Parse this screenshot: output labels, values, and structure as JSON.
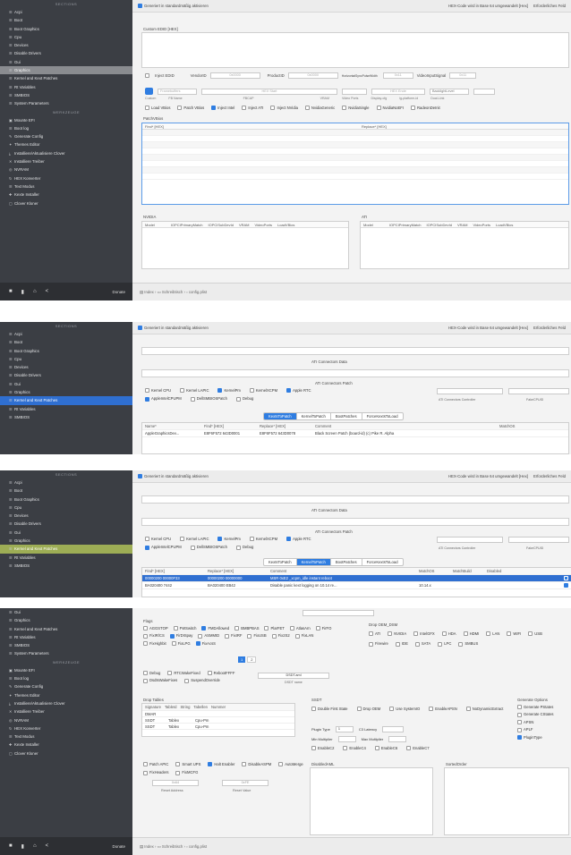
{
  "sidebar": {
    "section_main": "SECTIONS",
    "section_tools": "WERKZEUGE",
    "items": [
      "Acpi",
      "Boot",
      "Boot Graphics",
      "Cpu",
      "Devices",
      "Disable Drivers",
      "Gui",
      "Graphics",
      "Kernel and Kext Patches",
      "Rt Variables",
      "SMBIOS",
      "System Parameters"
    ],
    "tools": [
      "Mounte EFI",
      "Boot log",
      "Generate Config",
      "Themes Editor",
      "Installiere/Aktualisiere Clover",
      "Installiere Treiber",
      "NVRAM",
      "HEX Konverter",
      "Text Modus",
      "Kexte Installer",
      "Clover Kloner"
    ],
    "donate": "Donate"
  },
  "panel1": {
    "top_checkbox": "Generiert in standardmäßig aktivieren",
    "top_right": "HEX-Code wird in Base 64 umgewandelt [Hex]",
    "top_right2": "Erforderliches Feld",
    "custom_edid": "Custom EDID [HEX]",
    "inject_edid": "Inject EDID",
    "vendor_id": "VendorID",
    "vendor_placeholder": "0x0000",
    "product_id": "ProductID",
    "product_placeholder": "0x0000",
    "horizontal": "HorizontalSyncPulseWidth",
    "horizontal_val": "0x11",
    "video_input": "VideoInputSignal",
    "video_val": "0x11",
    "framebuffers": "Framebuffers",
    "hex_start": "HEX Start",
    "hex_end": "HEX Ende",
    "backlight": "BacklightLevel",
    "cols": [
      "Custom",
      "FB Name",
      "FBCAP",
      "VRAM",
      "Video Ports",
      "Display-cfg",
      "ig-platform-id",
      "Dual-Link"
    ],
    "checks": [
      "Load VBios",
      "Patch VBios",
      "Inject Intel",
      "Inject ATI",
      "Inject NVidia",
      "NvidiaGeneric",
      "NvidiaSingle",
      "NvidiaNoEFI",
      "RadeonDeInit"
    ],
    "checks_on": [
      false,
      false,
      true,
      false,
      false,
      false,
      false,
      false,
      false
    ],
    "patch_vbios_title": "PatchVBios",
    "find_hex": "Find* [HEX]",
    "replace_hex": "Replace* [HEX]",
    "nvidia_title": "NVIDIA",
    "ati_title": "ATI",
    "nvidia_cols": [
      "Model",
      "IOPCIPrimaryMatch",
      "IOPCISubDevId",
      "VRAM",
      "VideoPorts",
      "LoadVBios"
    ],
    "ati_cols": [
      "Model",
      "IOPCIPrimaryMatch",
      "IOPCISubDevId",
      "VRAM",
      "VideoPorts",
      "LoadVBios"
    ]
  },
  "pathbar": {
    "a": "Index",
    "b": "Schreibtisch",
    "c": "config.plist"
  },
  "panel2": {
    "ati_connectors": "ATI Connectors Data",
    "ati_patch": "ATI Connectors Patch",
    "checks": [
      "Kernel CPU",
      "Kernel LAPIC",
      "KernelPm",
      "KernelXCPM",
      "Apple RTC",
      "AppleIntelCPUPM",
      "DellSMBIOSPatch",
      "Debug"
    ],
    "checks_on": [
      false,
      false,
      true,
      false,
      true,
      true,
      false,
      false
    ],
    "ati_controller": "ATI Connectors Controller",
    "fake_cpuid": "FakeCPUID",
    "tabs": [
      "KextsToPatch",
      "KernelToPatch",
      "BootPatches",
      "ForceKextsToLoad"
    ],
    "active_tab": 0,
    "cols": [
      "Name*",
      "Find* [HEX]",
      "Replace* [HEX]",
      "Comment",
      "MatchOS"
    ],
    "row": [
      "AppleGraphicsDev...",
      "E8F6F572 643D0001",
      "E8F6F572 643D0078",
      "Black Screen Patch (board-id) (c) Pike R. Alpha"
    ]
  },
  "panel3": {
    "tabs": [
      "KextsToPatch",
      "KernelToPatch",
      "BootPatches",
      "ForceKextsToLoad"
    ],
    "active_tab": 1,
    "cols": [
      "Find* [HEX]",
      "Replace* [HEX]",
      "Comment",
      "MatchOS",
      "MatchBuild",
      "Disabled"
    ],
    "rows": [
      [
        "00000200 00000F33",
        "00000200 00000000",
        "MSR 0xE2 _xcpm_idle instant reboot",
        "",
        "",
        ""
      ],
      [
        "BA020400 7442",
        "BA020400 EB42",
        "Disable panic kext logging on 10.14 re...",
        "10.14.x",
        "",
        ""
      ]
    ]
  },
  "panel4": {
    "sidebar_items": [
      "Gui",
      "Graphics",
      "Kernel and Kext Patches",
      "Rt Variables",
      "SMBIOS",
      "System Parameters"
    ],
    "flags_title": "Flags",
    "flags": [
      "AGGSTOP",
      "FWSwitch",
      "FMDAllowed",
      "BMBPBAS",
      "PlarFET",
      "AtlasArn",
      "FirFO",
      "FixIR/CS",
      "FirDISpay",
      "ASMMID",
      "FixIRF",
      "FixUSB",
      "Fix2S2",
      "FixLAN",
      "FixHighbit",
      "FixLPG",
      "FixAcsS",
      "FixFirTest"
    ],
    "drop_oem": "Drop OEM_DSM",
    "drop_items": [
      "ATI",
      "NVIDIA",
      "IntelGFX",
      "HDA",
      "HDMI",
      "LAN",
      "WIFI",
      "USB",
      "Firewire",
      "IDE",
      "SATA",
      "LPC",
      "SMBUS"
    ],
    "page_buttons": [
      "1",
      "2"
    ],
    "debug": "Debug",
    "rtcwake": "RTCWakeFixed",
    "rebootfix": "RebootFFFF",
    "dsdtwake": "DsdtsWakeFixes",
    "suspend": "SuspendOverride",
    "dsdt_name": "DSDT.aml",
    "dsdt_label": "DSDT name",
    "drop_tables": "Drop Tables",
    "drop_cols": [
      "Signature",
      "TableId",
      "String",
      "Tabellen",
      "Nummer"
    ],
    "drop_rows": [
      [
        "DMAR",
        "",
        ""
      ],
      [
        "SSDT",
        "Tablex",
        "Cpu-Pm"
      ],
      [
        "SSDT",
        "Tablex",
        "Cpu-Pm"
      ]
    ],
    "ssdt": "SSDT",
    "ssdt_checks": [
      "Double First State",
      "Drop OEM",
      "Use SystemIO",
      "EnableAPSN",
      "NoDynamicExtract",
      "EnableC2",
      "EnableC4",
      "EnableC6",
      "EnableC7"
    ],
    "plugin_type": "Plugin Type",
    "plugin_val": "1",
    "c3_latency": "C3 Latency",
    "min_multiplier": "Min Multiplier",
    "max_multiplier": "Max Multiplier",
    "pstate_options": "Generate Options",
    "pstate_items": [
      "Generate PStates",
      "Generate CStates",
      "APSN",
      "APLF",
      "PluginType"
    ],
    "pstate_on": [
      false,
      false,
      false,
      false,
      true
    ],
    "disable_aml": "DisabledAML",
    "sorted_order": "SortedOrder",
    "bottom_checks": [
      "Patch APIC",
      "Smart UPS",
      "Halt Enabler",
      "DisableASPM",
      "AutoMerge",
      "FixHeaders",
      "FixMCFG"
    ],
    "reset_address": "Reset Address",
    "reset_value": "Reset Value",
    "reset_addr_val": "0x64",
    "reset_val_val": "0xFE"
  }
}
